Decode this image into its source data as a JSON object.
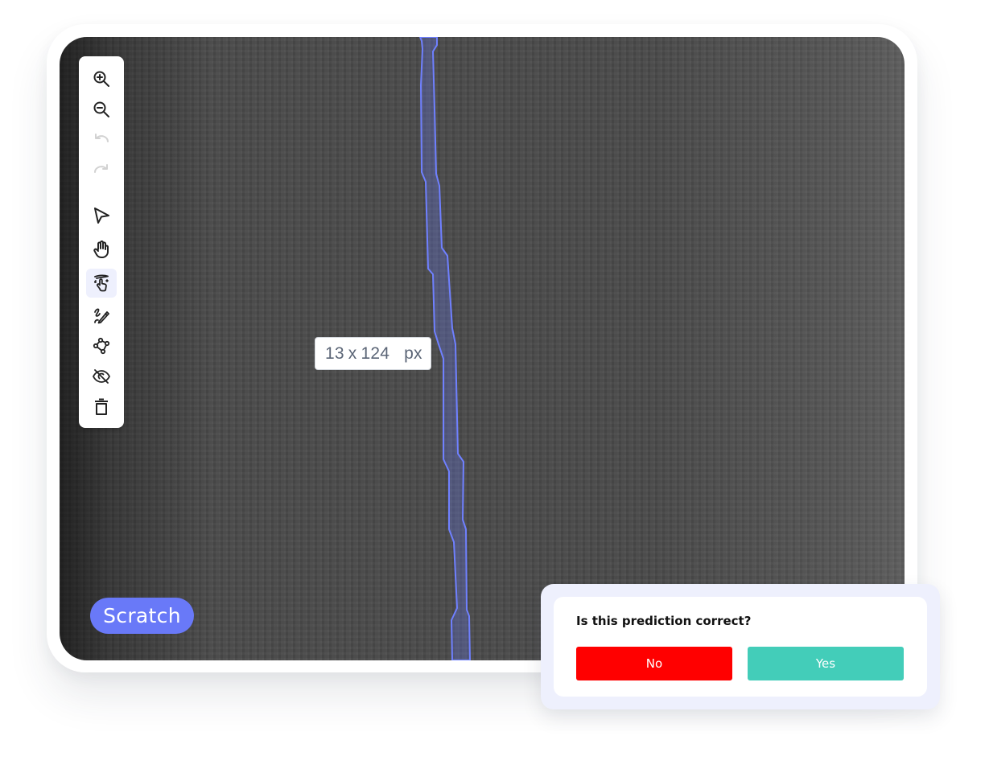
{
  "toolbar": {
    "tools": [
      {
        "id": "zoom-in",
        "label": "Zoom in",
        "state": "enabled"
      },
      {
        "id": "zoom-out",
        "label": "Zoom out",
        "state": "enabled"
      },
      {
        "id": "undo",
        "label": "Undo",
        "state": "disabled"
      },
      {
        "id": "redo",
        "label": "Redo",
        "state": "disabled"
      },
      {
        "id": "select",
        "label": "Select",
        "state": "enabled"
      },
      {
        "id": "pan",
        "label": "Pan",
        "state": "enabled"
      },
      {
        "id": "smart-select",
        "label": "Smart select",
        "state": "active"
      },
      {
        "id": "brush",
        "label": "Brush",
        "state": "enabled"
      },
      {
        "id": "polygon",
        "label": "Polygon",
        "state": "enabled"
      },
      {
        "id": "hide",
        "label": "Hide annotations",
        "state": "enabled"
      },
      {
        "id": "delete",
        "label": "Delete",
        "state": "enabled"
      }
    ]
  },
  "annotation": {
    "label": "Scratch",
    "color": "#6979f8",
    "size_width": "13",
    "size_separator": "x",
    "size_height": "124",
    "size_unit": "px"
  },
  "prompt": {
    "question": "Is this prediction correct?",
    "no_label": "No",
    "yes_label": "Yes",
    "no_color": "#ff0000",
    "yes_color": "#43cdb9"
  }
}
